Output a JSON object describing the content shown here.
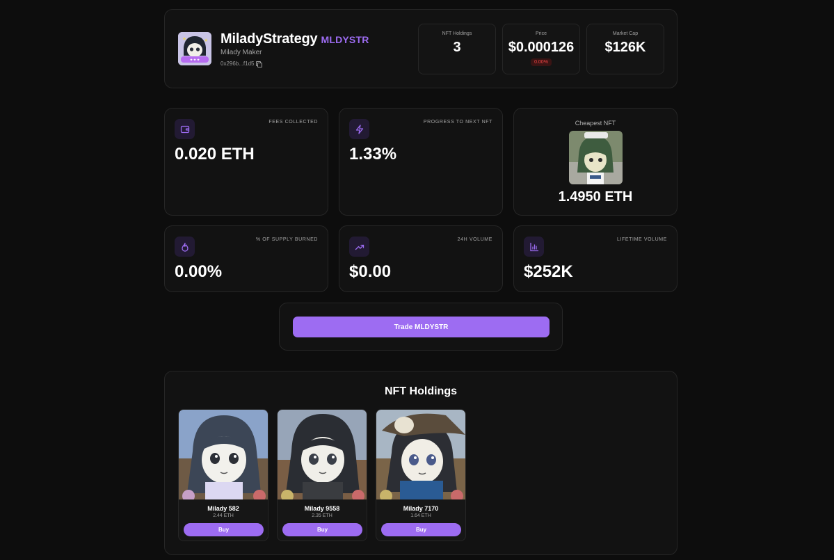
{
  "header": {
    "name": "MiladyStrategy",
    "ticker": "MLDYSTR",
    "subtitle": "Milady Maker",
    "address": "0x296b...f1d5",
    "stats": {
      "holdings": {
        "label": "NFT Holdings",
        "value": "3"
      },
      "price": {
        "label": "Price",
        "value": "$0.000126",
        "change": "0.00%"
      },
      "market_cap": {
        "label": "Market Cap",
        "value": "$126K"
      }
    }
  },
  "metrics": {
    "fees": {
      "label": "FEES COLLECTED",
      "value": "0.020 ETH",
      "icon": "wallet-icon"
    },
    "progress": {
      "label": "PROGRESS TO NEXT NFT",
      "value": "1.33%",
      "icon": "lightning-icon"
    },
    "cheapest": {
      "label": "Cheapest NFT",
      "value": "1.4950 ETH"
    },
    "burned": {
      "label": "% OF SUPPLY BURNED",
      "value": "0.00%",
      "icon": "flame-icon"
    },
    "volume24h": {
      "label": "24H VOLUME",
      "value": "$0.00",
      "icon": "trending-up-icon"
    },
    "lifetime": {
      "label": "LIFETIME VOLUME",
      "value": "$252K",
      "icon": "bar-chart-icon"
    }
  },
  "trade": {
    "label": "Trade MLDYSTR"
  },
  "holdings": {
    "title": "NFT Holdings",
    "items": [
      {
        "name": "Milady 582",
        "price": "2.44 ETH",
        "buy": "Buy"
      },
      {
        "name": "Milady 9558",
        "price": "2.35 ETH",
        "buy": "Buy"
      },
      {
        "name": "Milady 7170",
        "price": "1.64 ETH",
        "buy": "Buy"
      }
    ]
  },
  "colors": {
    "accent": "#9d6cf2",
    "background": "#0d0d0d",
    "card": "#121212",
    "negative": "#ef4444"
  }
}
